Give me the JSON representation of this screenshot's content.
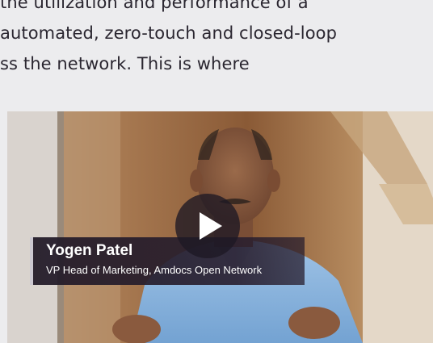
{
  "article": {
    "lines": [
      "the utilization and performance of a",
      "automated, zero-touch and closed-loop",
      "ss the network. This is where"
    ]
  },
  "video": {
    "speaker_name": "Yogen Patel",
    "speaker_title": "VP Head of Marketing, Amdocs Open Network",
    "play_icon": "play-icon"
  },
  "colors": {
    "background": "#ececee",
    "text": "#2a2630",
    "lower_third": "#221a28",
    "play_button": "#1e1824"
  }
}
